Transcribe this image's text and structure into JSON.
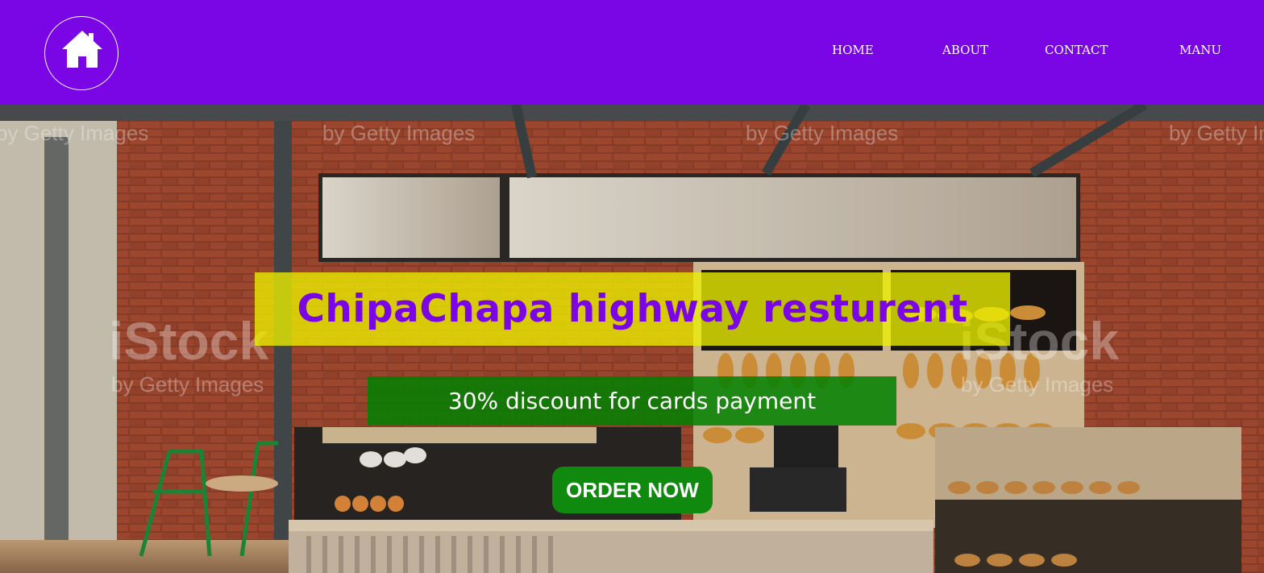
{
  "nav": {
    "logo_icon": "home-icon",
    "links": [
      {
        "label": "HOME"
      },
      {
        "label": "ABOUT"
      },
      {
        "label": "CONTACT"
      },
      {
        "label": "MANU"
      }
    ]
  },
  "hero": {
    "title": "ChipaChapa highway resturent",
    "discount": "30% discount for cards payment",
    "order_button": "ORDER NOW"
  },
  "watermark": {
    "brand": "iStock",
    "byline": "by Getty Images"
  },
  "colors": {
    "nav_background": "#7a05e5",
    "title_box": "#ecf000",
    "title_text": "#7a05e5",
    "discount_box": "#008000",
    "order_button": "#0f8a0f"
  }
}
